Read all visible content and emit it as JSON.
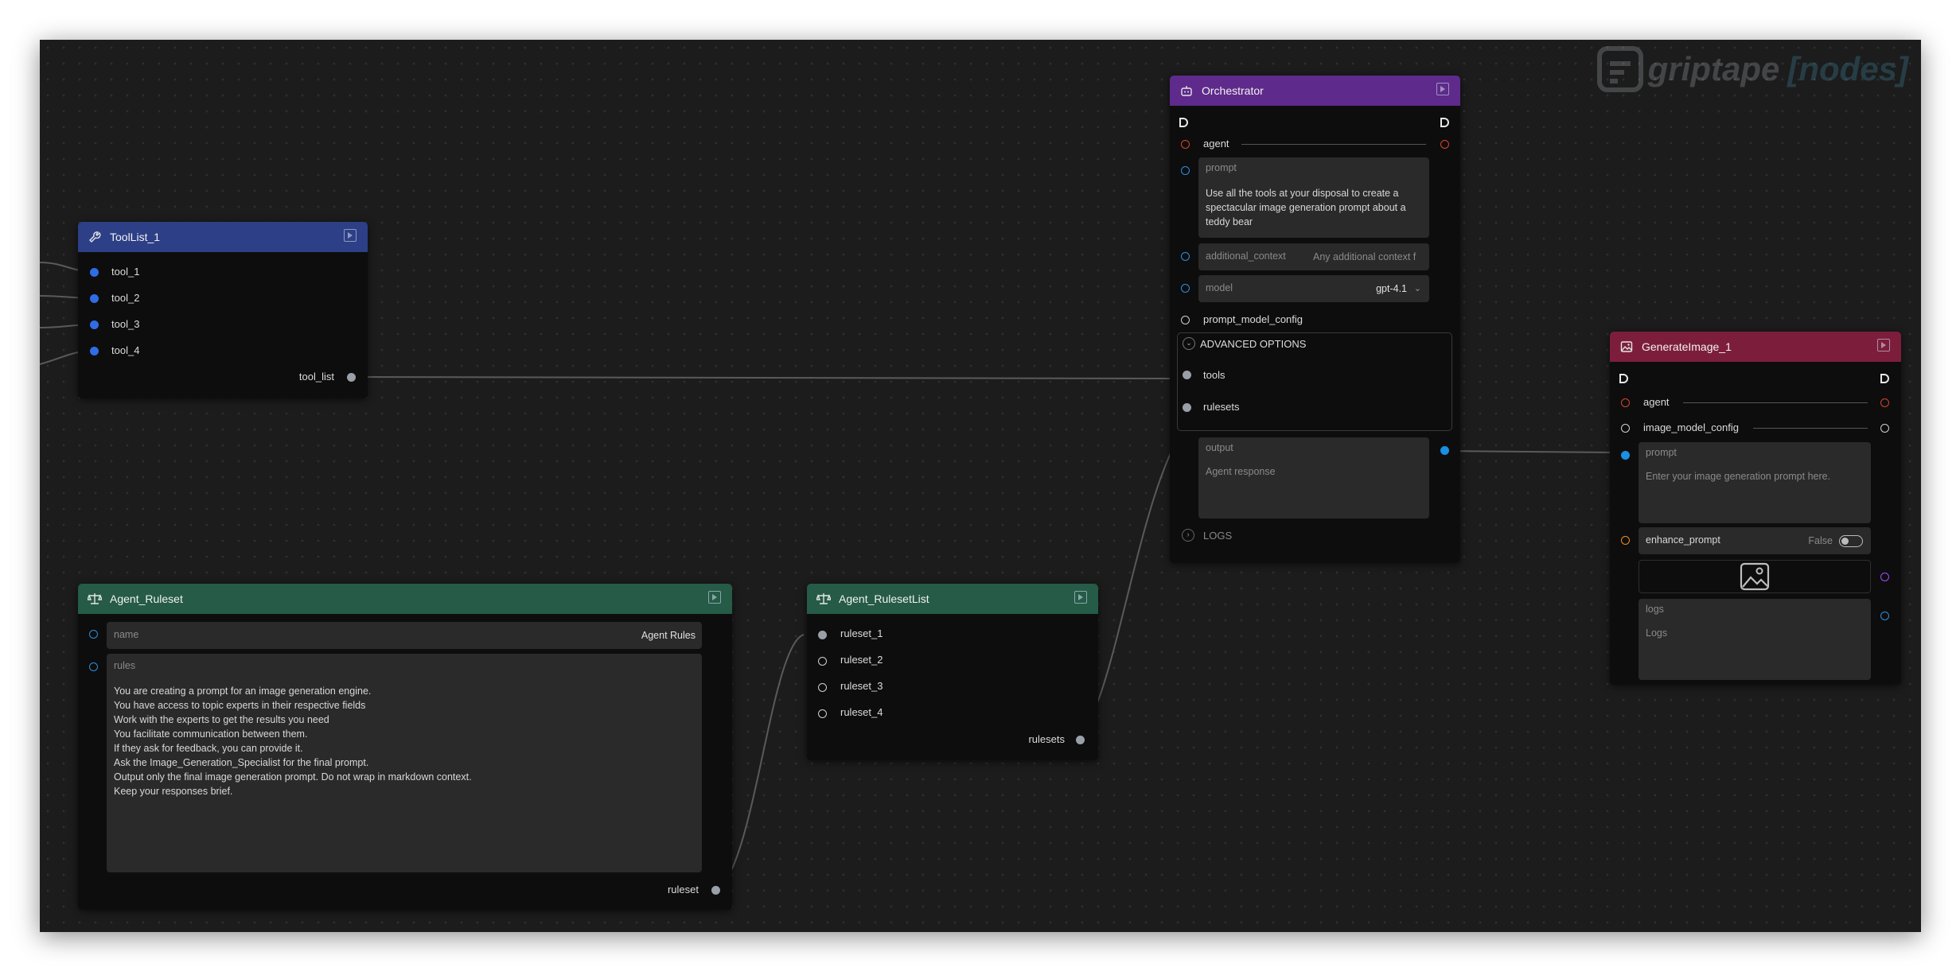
{
  "brand": {
    "logo_text": "griptape",
    "logo_suffix": "[nodes]"
  },
  "colors": {
    "canvas_bg": "#1c1c1c",
    "toollist_header": "#2d3f86",
    "ruleset_header": "#255b47",
    "orchestrator_header": "#5e2a8b",
    "generate_header": "#7c1e3b"
  },
  "toollist": {
    "title": "ToolList_1",
    "inputs": [
      "tool_1",
      "tool_2",
      "tool_3",
      "tool_4"
    ],
    "output": "tool_list"
  },
  "ruleset": {
    "title": "Agent_Ruleset",
    "name_label": "name",
    "name_value": "Agent Rules",
    "rules_label": "rules",
    "rules_text": "You are creating a prompt for an image generation engine.\nYou have access to topic experts in their respective fields\nWork with the experts to get the results you need\nYou facilitate communication between them.\nIf they ask for feedback, you can provide it.\nAsk the Image_Generation_Specialist for the final prompt.\nOutput only the final image generation prompt. Do not wrap in markdown context.\nKeep your responses brief.",
    "output": "ruleset"
  },
  "rulesetlist": {
    "title": "Agent_RulesetList",
    "inputs": [
      "ruleset_1",
      "ruleset_2",
      "ruleset_3",
      "ruleset_4"
    ],
    "output": "rulesets"
  },
  "orchestrator": {
    "title": "Orchestrator",
    "agent_label": "agent",
    "prompt_label": "prompt",
    "prompt_text": "Use all the tools at your disposal to create a spectacular image generation prompt about a teddy bear",
    "additional_context_label": "additional_context",
    "additional_context_placeholder": "Any additional context f",
    "model_label": "model",
    "model_value": "gpt-4.1",
    "prompt_model_config_label": "prompt_model_config",
    "advanced_label": "ADVANCED OPTIONS",
    "tools_label": "tools",
    "rulesets_label": "rulesets",
    "output_label": "output",
    "output_placeholder": "Agent response",
    "logs_label": "LOGS"
  },
  "generate": {
    "title": "GenerateImage_1",
    "agent_label": "agent",
    "image_model_config_label": "image_model_config",
    "prompt_label": "prompt",
    "prompt_placeholder": "Enter your image generation prompt here.",
    "enhance_label": "enhance_prompt",
    "enhance_value": "False",
    "image_icon": "image-icon",
    "logs_label": "logs",
    "logs_placeholder": "Logs"
  }
}
